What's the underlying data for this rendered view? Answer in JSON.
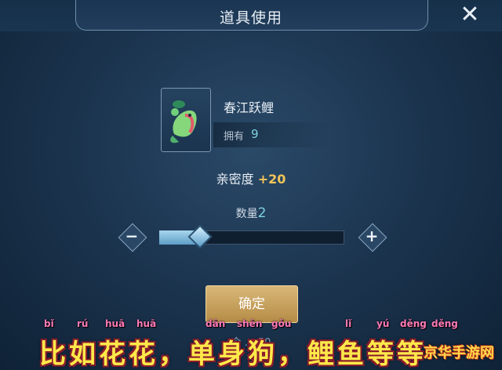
{
  "dialog": {
    "title": "道具使用",
    "close_icon": "close-icon"
  },
  "item": {
    "name": "春江跃鲤",
    "own_label": "拥有",
    "own_value": "9",
    "icon": "koi-fish-icon"
  },
  "affinity": {
    "label": "亲密度",
    "value": "+20"
  },
  "quantity": {
    "label": "数量",
    "value": "2",
    "slider_fraction": 0.22
  },
  "confirm": {
    "label": "确定"
  },
  "bottom_text": "今 … 50",
  "caption": {
    "text": "比如花花，单身狗，鲤鱼等等",
    "pinyin": [
      "bǐ",
      "rú",
      "huā",
      "huā",
      "dān",
      "shēn",
      "gǒu",
      "lǐ",
      "yú",
      "děng",
      "děng"
    ]
  },
  "watermark": "京华手游网",
  "colors": {
    "accent_value": "#f3c45a",
    "quantity_value": "#7fd3e0",
    "caption": "#ffe94a"
  }
}
